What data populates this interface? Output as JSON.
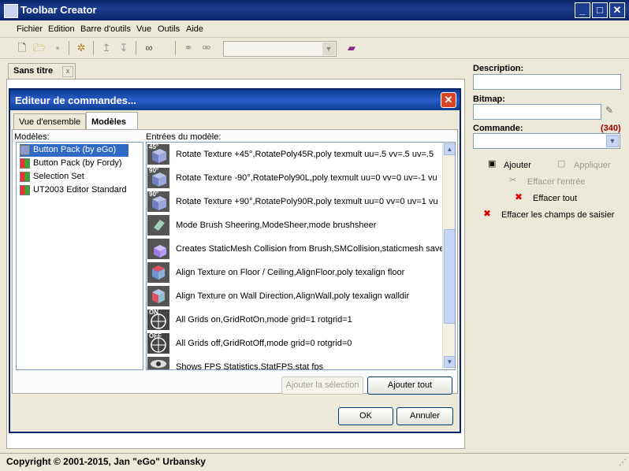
{
  "window": {
    "title": "Toolbar Creator"
  },
  "menu": [
    "Fichier",
    "Edition",
    "Barre d'outils",
    "Vue",
    "Outils",
    "Aide"
  ],
  "document_tab": {
    "label": "Sans titre",
    "close": "x"
  },
  "right_panel": {
    "description_label": "Description:",
    "bitmap_label": "Bitmap:",
    "commande_label": "Commande:",
    "commande_count": "(340)",
    "ajouter": "Ajouter",
    "appliquer": "Appliquer",
    "effacer_entree": "Effacer l'entrée",
    "effacer_tout": "Effacer tout",
    "effacer_champs": "Effacer les champs de saisier"
  },
  "dialog": {
    "title": "Editeur de commandes...",
    "tabs": [
      "Vue d'ensemble",
      "Modèles"
    ],
    "modeles_label": "Modèles:",
    "entrees_label": "Entrées du modèle:",
    "modeles": [
      "Button Pack (by eGo)",
      "Button Pack (by Fordy)",
      "Selection Set",
      "UT2003 Editor Standard"
    ],
    "entries": [
      {
        "text": "Rotate Texture +45°,RotatePoly45R,poly texmult uu=.5 vv=.5 uv=.5",
        "badge": "45°"
      },
      {
        "text": "Rotate Texture -90°,RotatePoly90L,poly texmult uu=0 vv=0 uv=-1 vu",
        "badge": "90°"
      },
      {
        "text": "Rotate Texture +90°,RotatePoly90R,poly texmult uu=0 vv=0 uv=1 vu",
        "badge": "90°"
      },
      {
        "text": "Mode Brush Sheering,ModeSheer,mode brushsheer",
        "badge": ""
      },
      {
        "text": "Creates StaticMesh Collision from Brush,SMCollision,staticmesh savebr",
        "badge": ""
      },
      {
        "text": "Align Texture on Floor / Ceiling,AlignFloor,poly texalign floor",
        "badge": ""
      },
      {
        "text": "Align Texture on Wall Direction,AlignWall,poly texalign walldir",
        "badge": ""
      },
      {
        "text": "All Grids on,GridRotOn,mode grid=1 rotgrid=1",
        "badge": "ON"
      },
      {
        "text": "All Grids off,GridRotOff,mode grid=0 rotgrid=0",
        "badge": "OFF"
      },
      {
        "text": "Shows FPS Statistics,StatFPS,stat fps",
        "badge": ""
      }
    ],
    "btn_ajouter_selection": "Ajouter la sélection",
    "btn_ajouter_tout": "Ajouter tout",
    "btn_ok": "OK",
    "btn_annuler": "Annuler"
  },
  "status": {
    "copyright": "Copyright © 2001-2015, Jan \"eGo\" Urbansky"
  },
  "colors": {
    "titlebar": "#0a246a",
    "selection": "#316ac5",
    "count": "#a00000",
    "close": "#d64527"
  }
}
